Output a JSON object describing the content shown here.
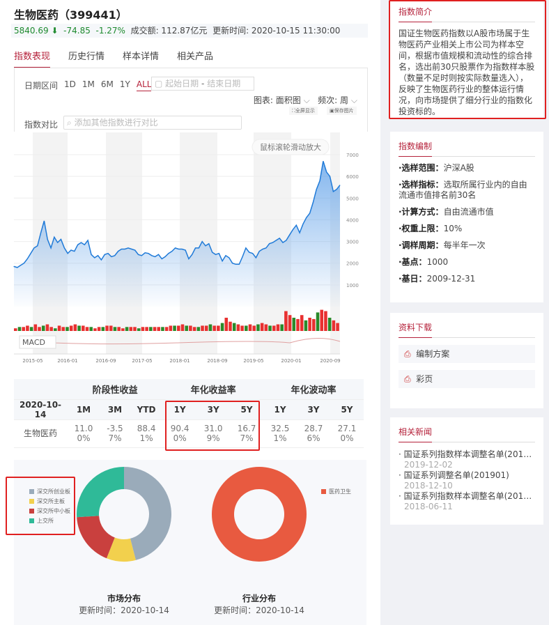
{
  "header": {
    "title": "生物医药（399441）",
    "price": "5840.69",
    "arrow": "⬇",
    "change": "-74.85",
    "pct": "-1.27%",
    "turnover": "成交额: 112.87亿元",
    "updated": "更新时间: 2020-10-15 11:30:00"
  },
  "tabs": [
    {
      "label": "指数表现"
    },
    {
      "label": "历史行情"
    },
    {
      "label": "样本详情"
    },
    {
      "label": "相关产品"
    }
  ],
  "toolbar": {
    "range_label": "日期区间",
    "ranges": [
      "1D",
      "1M",
      "6M",
      "1Y",
      "ALL"
    ],
    "start_placeholder": "起始日期",
    "sep": "-",
    "end_placeholder": "结束日期",
    "chart_type_label": "图表:",
    "chart_type": "面积图",
    "freq_label": "频次:",
    "freq": "周",
    "fullscreen": "全屏显示",
    "save_image": "保存图片",
    "compare_label": "指数对比",
    "compare_placeholder": "添加其他指数进行对比"
  },
  "chart_data": {
    "type": "area",
    "hint": "鼠标滚轮滑动放大",
    "macd_label": "MACD",
    "ylim": [
      0,
      7000
    ],
    "yticks": [
      "1000",
      "2000",
      "3000",
      "4000",
      "5000",
      "6000",
      "7000"
    ],
    "xticks": [
      "2015-05",
      "2016-01",
      "2016-09",
      "2017-05",
      "2018-01",
      "2018-09",
      "2019-05",
      "2020-01",
      "2020-09"
    ],
    "values": [
      1850,
      1800,
      1900,
      2000,
      2200,
      2450,
      2700,
      2800,
      3400,
      3950,
      3100,
      2700,
      3200,
      2950,
      3100,
      2700,
      2450,
      2600,
      2550,
      2850,
      2950,
      2850,
      3050,
      2400,
      2250,
      2350,
      2150,
      2400,
      2450,
      2300,
      2350,
      2550,
      2650,
      2650,
      2700,
      2650,
      2600,
      2400,
      2350,
      2480,
      2450,
      2350,
      2300,
      2400,
      2200,
      2300,
      2450,
      2550,
      2700,
      2650,
      2650,
      2600,
      2200,
      2400,
      2700,
      2700,
      3000,
      2800,
      2900,
      2500,
      2400,
      2450,
      2100,
      2350,
      2250,
      2000,
      1950,
      1950,
      2300,
      2700,
      2500,
      2450,
      2250,
      2550,
      2650,
      2700,
      2900,
      2950,
      3050,
      3150,
      2950,
      3050,
      3300,
      3550,
      3750,
      3400,
      3800,
      4100,
      4300,
      4800,
      5400,
      5800,
      6700,
      6200,
      6000,
      5300,
      5400,
      5600
    ],
    "volume": [
      2,
      3,
      3,
      4,
      3,
      5,
      3,
      4,
      5,
      3,
      2,
      4,
      3,
      3,
      4,
      5,
      4,
      4,
      3,
      3,
      2,
      3,
      3,
      4,
      4,
      3,
      3,
      2,
      3,
      3,
      3,
      2,
      3,
      3,
      3,
      3,
      3,
      3,
      3,
      4,
      4,
      4,
      5,
      4,
      4,
      3,
      3,
      4,
      4,
      5,
      4,
      4,
      6,
      10,
      7,
      6,
      5,
      4,
      4,
      5,
      4,
      5,
      6,
      5,
      4,
      4,
      5,
      5,
      15,
      12,
      10,
      9,
      12,
      8,
      10,
      9,
      14,
      16,
      15,
      10,
      8,
      6
    ]
  },
  "performance": {
    "groups": [
      "阶段性收益",
      "年化收益率",
      "年化波动率"
    ],
    "date": "2020-10-14",
    "cols": [
      "1M",
      "3M",
      "YTD",
      "1Y",
      "3Y",
      "5Y",
      "1Y",
      "3Y",
      "5Y"
    ],
    "row_name": "生物医药",
    "values": [
      [
        "11.0",
        "0%"
      ],
      [
        "-3.5",
        "7%"
      ],
      [
        "88.4",
        "1%"
      ],
      [
        "90.4",
        "0%"
      ],
      [
        "31.0",
        "9%"
      ],
      [
        "16.7",
        "7%"
      ],
      [
        "32.5",
        "1%"
      ],
      [
        "28.7",
        "6%"
      ],
      [
        "27.1",
        "0%"
      ]
    ]
  },
  "market_dist": {
    "title": "市场分布",
    "updated": "更新时间：2020-10-14",
    "slices": [
      {
        "name": "深交所创业板",
        "value": 46,
        "color": "#9aabba"
      },
      {
        "name": "深交所主板",
        "value": 10,
        "color": "#f2d04d"
      },
      {
        "name": "深交所中小板",
        "value": 18,
        "color": "#c9403e"
      },
      {
        "name": "上交所",
        "value": 26,
        "color": "#2fba98"
      }
    ]
  },
  "industry_dist": {
    "title": "行业分布",
    "updated": "更新时间：2020-10-14",
    "slices": [
      {
        "name": "医药卫生",
        "value": 100,
        "color": "#e85a40"
      }
    ]
  },
  "sidebar": {
    "intro": {
      "title": "指数简介",
      "text": "国证生物医药指数以A股市场属于生物医药产业相关上市公司为样本空间，根据市值规模和流动性的综合排名，选出前30只股票作为指数样本股（数量不足时则按实际数量选入），反映了生物医药行业的整体运行情况，向市场提供了细分行业的指数化投资标的。"
    },
    "method": {
      "title": "指数编制",
      "items": [
        {
          "k": "·选样范围：",
          "v": "沪深A股"
        },
        {
          "k": "·选样指标：",
          "v": "选取所属行业内的自由流通市值排名前30名"
        },
        {
          "k": "·计算方式：",
          "v": "自由流通市值"
        },
        {
          "k": "·权重上限：",
          "v": "10%"
        },
        {
          "k": "·调样周期：",
          "v": "每半年一次"
        },
        {
          "k": "·基点：",
          "v": "1000"
        },
        {
          "k": "·基日：",
          "v": "2009-12-31"
        }
      ]
    },
    "downloads": {
      "title": "资料下载",
      "items": [
        "编制方案",
        "彩页"
      ]
    },
    "news": {
      "title": "相关新闻",
      "items": [
        {
          "t": "· 国证系列指数样本调整名单(2019...",
          "d": "2019-12-02"
        },
        {
          "t": "· 国证系列调整名单(201901)",
          "d": "2018-12-10"
        },
        {
          "t": "· 国证系列指数样本调整名单(2018...",
          "d": "2018-06-11"
        }
      ]
    }
  }
}
